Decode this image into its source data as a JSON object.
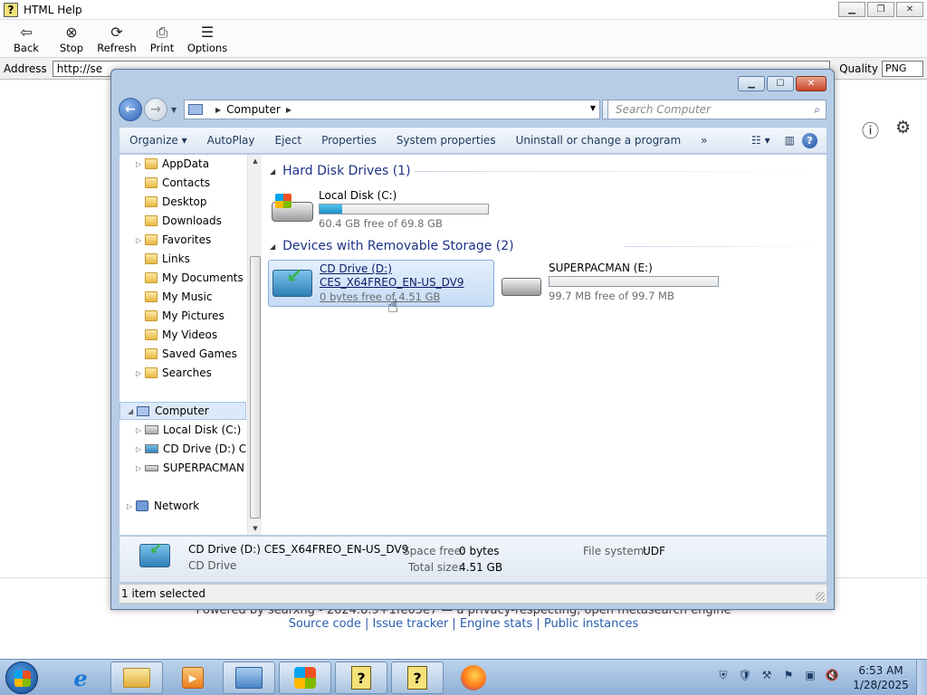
{
  "helpapp": {
    "title": "HTML Help",
    "toolbar": [
      {
        "label": "Back",
        "icon": "⇦"
      },
      {
        "label": "Stop",
        "icon": "⊗"
      },
      {
        "label": "Refresh",
        "icon": "⟳"
      },
      {
        "label": "Print",
        "icon": "⎙"
      },
      {
        "label": "Options",
        "icon": "☰"
      }
    ],
    "address_label": "Address",
    "address_value": "http://se",
    "quality_label": "Quality",
    "quality_value": "PNG",
    "footer_line1": "Powered by searxng - 2024.8.9+1fe05e7 — a privacy-respecting, open metasearch engine",
    "footer_line2": "Source code | Issue tracker | Engine stats | Public instances"
  },
  "explorer": {
    "breadcrumb": "Computer",
    "search_placeholder": "Search Computer",
    "commands": [
      "Organize",
      "AutoPlay",
      "Eject",
      "Properties",
      "System properties",
      "Uninstall or change a program",
      "»"
    ],
    "nav": {
      "folders": [
        "AppData",
        "Contacts",
        "Desktop",
        "Downloads",
        "Favorites",
        "Links",
        "My Documents",
        "My Music",
        "My Pictures",
        "My Videos",
        "Saved Games",
        "Searches"
      ],
      "computer": "Computer",
      "drives": [
        "Local Disk (C:)",
        "CD Drive (D:) CES",
        "SUPERPACMAN"
      ],
      "network": "Network"
    },
    "groups": {
      "hdd": "Hard Disk Drives (1)",
      "removable": "Devices with Removable Storage (2)"
    },
    "drives": {
      "c": {
        "name": "Local Disk (C:)",
        "free": "60.4 GB free of 69.8 GB",
        "used_fraction": 0.135
      },
      "d": {
        "name": "CD Drive (D:)",
        "label": "CES_X64FREO_EN-US_DV9",
        "free": "0 bytes free of 4.51 GB"
      },
      "e": {
        "name": "SUPERPACMAN (E:)",
        "free": "99.7 MB free of 99.7 MB",
        "used_fraction": 0.0
      }
    },
    "details": {
      "name": "CD Drive (D:) CES_X64FREO_EN-US_DV9",
      "type": "CD Drive",
      "space_free_label": "Space free:",
      "space_free": "0 bytes",
      "total_size_label": "Total size:",
      "total_size": "4.51 GB",
      "fs_label": "File system:",
      "fs": "UDF"
    },
    "status": "1 item selected"
  },
  "taskbar": {
    "time": "6:53 AM",
    "date": "1/28/2025"
  }
}
